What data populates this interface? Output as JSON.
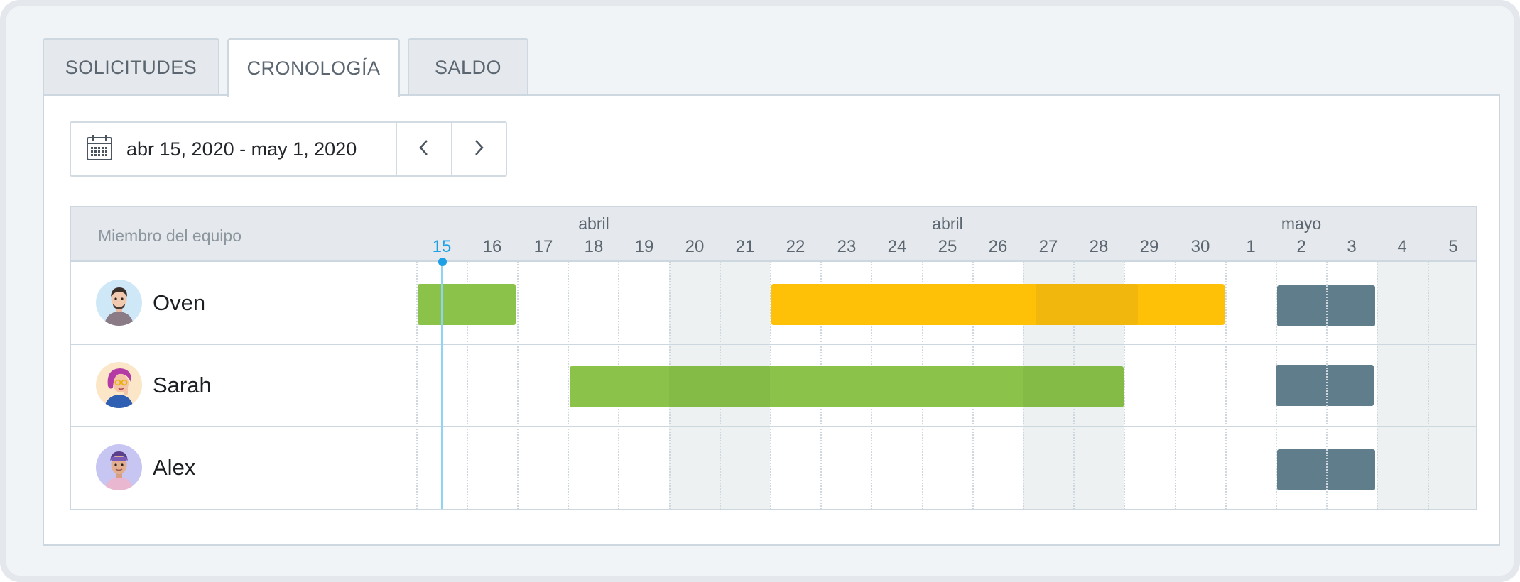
{
  "tabs": [
    {
      "label": "SOLICITUDES",
      "active": false
    },
    {
      "label": "CRONOLOGÍA",
      "active": true
    },
    {
      "label": "SALDO",
      "active": false
    }
  ],
  "date_range": {
    "text": "abr 15, 2020 - may 1, 2020",
    "icon": "calendar-icon",
    "prev_icon": "chevron-left-icon",
    "next_icon": "chevron-right-icon"
  },
  "timeline": {
    "member_header": "Miembro del equipo",
    "months": [
      "abril",
      "abril",
      "mayo"
    ],
    "days": [
      "15",
      "16",
      "17",
      "18",
      "19",
      "20",
      "21",
      "22",
      "23",
      "24",
      "25",
      "26",
      "27",
      "28",
      "29",
      "30",
      "1",
      "2",
      "3",
      "4",
      "5"
    ],
    "today": "15",
    "members": [
      {
        "name": "Oven"
      },
      {
        "name": "Sarah"
      },
      {
        "name": "Alex"
      }
    ]
  },
  "colors": {
    "vacation_green": "#8bc34a",
    "sick_yellow": "#ffc107",
    "other_slate": "#607d8b",
    "today_blue": "#1ea0e6",
    "weekend_band": "#eef1f2"
  }
}
